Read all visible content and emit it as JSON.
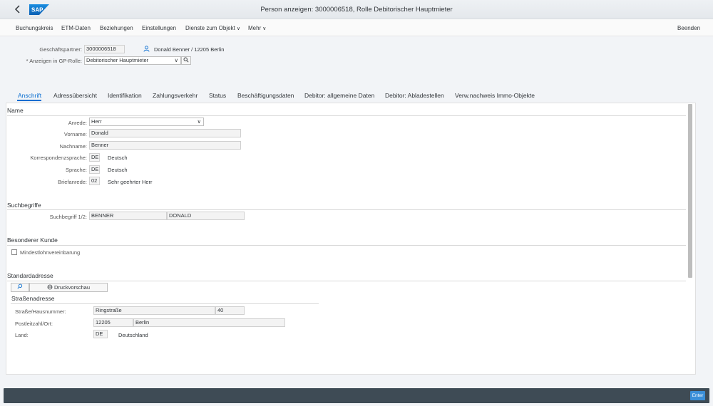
{
  "shell": {
    "title": "Person anzeigen: 3000006518, Rolle Debitorischer Hauptmieter",
    "logo_text": "SAP",
    "brand_color": "#0a6ed1"
  },
  "menu": {
    "items": [
      "Buchungskreis",
      "ETM-Daten",
      "Beziehungen",
      "Einstellungen",
      "Dienste zum Objekt",
      "Mehr"
    ],
    "exit": "Beenden"
  },
  "header": {
    "partner_label": "Geschäftspartner:",
    "partner_value": "3000006518",
    "partner_desc": "Donald Benner / 12205 Berlin",
    "role_label": "* Anzeigen in GP-Rolle:",
    "role_value": "Debitorischer Hauptmieter"
  },
  "tabs": [
    "Anschrift",
    "Adressübersicht",
    "Identifikation",
    "Zahlungsverkehr",
    "Status",
    "Beschäftigungsdaten",
    "Debitor: allgemeine Daten",
    "Debitor: Abladestellen",
    "Verw.nachweis Immo-Objekte"
  ],
  "name_section": {
    "title": "Name",
    "anrede_label": "Anrede:",
    "anrede_value": "Herr",
    "vorname_label": "Vorname:",
    "vorname_value": "Donald",
    "nachname_label": "Nachname:",
    "nachname_value": "Benner",
    "korr_label": "Korrespondenzsprache:",
    "korr_code": "DE",
    "korr_text": "Deutsch",
    "sprache_label": "Sprache:",
    "sprache_code": "DE",
    "sprache_text": "Deutsch",
    "brief_label": "Briefanrede:",
    "brief_code": "02",
    "brief_text": "Sehr geehrter Herr"
  },
  "search_section": {
    "title": "Suchbegriffe",
    "label": "Suchbegriff 1/2:",
    "value1": "BENNER",
    "value2": "DONALD"
  },
  "special_section": {
    "title": "Besonderer Kunde",
    "checkbox_label": "Mindestlohnvereinbarung",
    "checked": false
  },
  "address_section": {
    "title": "Standardadresse",
    "preview_button": "Druckvorschau",
    "street_title": "Straßenadresse",
    "street_label": "Straße/Hausnummer:",
    "street_value": "Ringstraße",
    "house_value": "40",
    "plz_label": "Postleitzahl/Ort:",
    "plz_value": "12205",
    "city_value": "Berlin",
    "land_label": "Land:",
    "land_code": "DE",
    "land_text": "Deutschland"
  },
  "footer": {
    "enter_label": "Enter"
  }
}
